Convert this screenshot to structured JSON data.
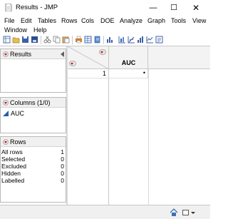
{
  "window": {
    "title": "Results - JMP",
    "minimize_glyph": "—",
    "maximize_glyph": "☐",
    "close_glyph": "✕"
  },
  "menu": {
    "row1": [
      "File",
      "Edit",
      "Tables",
      "Rows",
      "Cols",
      "DOE",
      "Analyze",
      "Graph",
      "Tools",
      "View"
    ],
    "row2": [
      "Window",
      "Help"
    ]
  },
  "toolbar": {
    "icons": [
      "new-table-icon",
      "open-icon",
      "save-icon",
      "save-as-icon",
      "cut-icon",
      "copy-icon",
      "paste-icon",
      "print-icon",
      "data-table-icon",
      "journal-icon",
      "distribution-icon",
      "fit-y-by-x-icon",
      "fit-model-icon",
      "graph-builder-icon",
      "control-chart-icon",
      "script-icon"
    ]
  },
  "panels": {
    "results": {
      "title": "Results"
    },
    "columns": {
      "title": "Columns (1/0)",
      "items": [
        {
          "name": "AUC",
          "icon": "continuous-column-icon"
        }
      ]
    },
    "rows": {
      "title": "Rows",
      "items": [
        {
          "label": "All rows",
          "value": "1"
        },
        {
          "label": "Selected",
          "value": "0"
        },
        {
          "label": "Excluded",
          "value": "0"
        },
        {
          "label": "Hidden",
          "value": "0"
        },
        {
          "label": "Labelled",
          "value": "0"
        }
      ]
    }
  },
  "grid": {
    "columns": [
      "AUC"
    ],
    "rows": [
      {
        "number": "1",
        "cells": [
          "•"
        ]
      }
    ]
  },
  "colors": {
    "red_triangle": "#d01010",
    "column_icon_blue": "#2a5db0",
    "header_bg": "#f3f3f3"
  },
  "statusbar": {
    "icons": [
      "home-icon",
      "window-list-icon"
    ]
  }
}
